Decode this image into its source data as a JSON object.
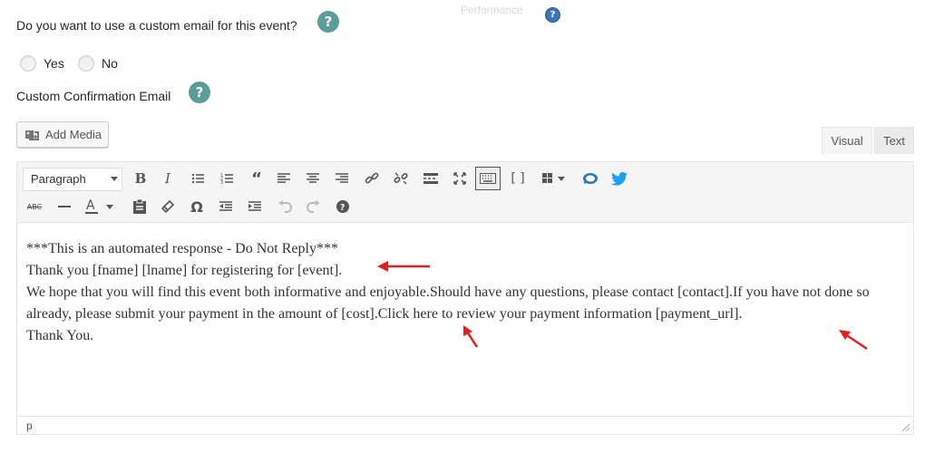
{
  "form": {
    "custom_email_question": "Do you want to use a custom email for this event?",
    "help_symbol": "?",
    "faded_tab_label": "Performance",
    "options": {
      "yes": "Yes",
      "no": "No"
    },
    "confirmation_label": "Custom Confirmation Email"
  },
  "editor": {
    "add_media_label": "Add Media",
    "tabs": {
      "visual": "Visual",
      "text": "Text"
    },
    "format_select": "Paragraph",
    "toolbar_row1": [
      "bold-icon",
      "italic-icon",
      "bullet-list-icon",
      "numbered-list-icon",
      "blockquote-icon",
      "align-left-icon",
      "align-center-icon",
      "align-right-icon",
      "link-icon",
      "unlink-icon",
      "read-more-icon",
      "fullscreen-icon",
      "toolbar-toggle-icon",
      "shortcode-icon",
      "grid-icon",
      "chat-icon",
      "twitter-icon"
    ],
    "toolbar_row2": [
      "strikethrough-icon",
      "horizontal-line-icon",
      "text-color-icon",
      "paste-text-icon",
      "clear-formatting-icon",
      "special-character-icon",
      "outdent-icon",
      "indent-icon",
      "undo-icon",
      "redo-icon",
      "help-icon"
    ],
    "content": {
      "line1": "***This is an automated response - Do Not Reply***",
      "line2": "Thank you [fname] [lname] for registering for [event].",
      "line3": "We hope that you will find this event both informative and enjoyable.Should have any questions, please contact [contact].If you have not done so already, please submit your payment in the amount of [cost].Click here to review your payment information [payment_url].",
      "line4": "Thank You."
    },
    "status_path": "p"
  },
  "colors": {
    "help_teal": "#5a9e99",
    "annotation_arrow": "#e02020",
    "twitter_blue": "#1da1f2"
  }
}
